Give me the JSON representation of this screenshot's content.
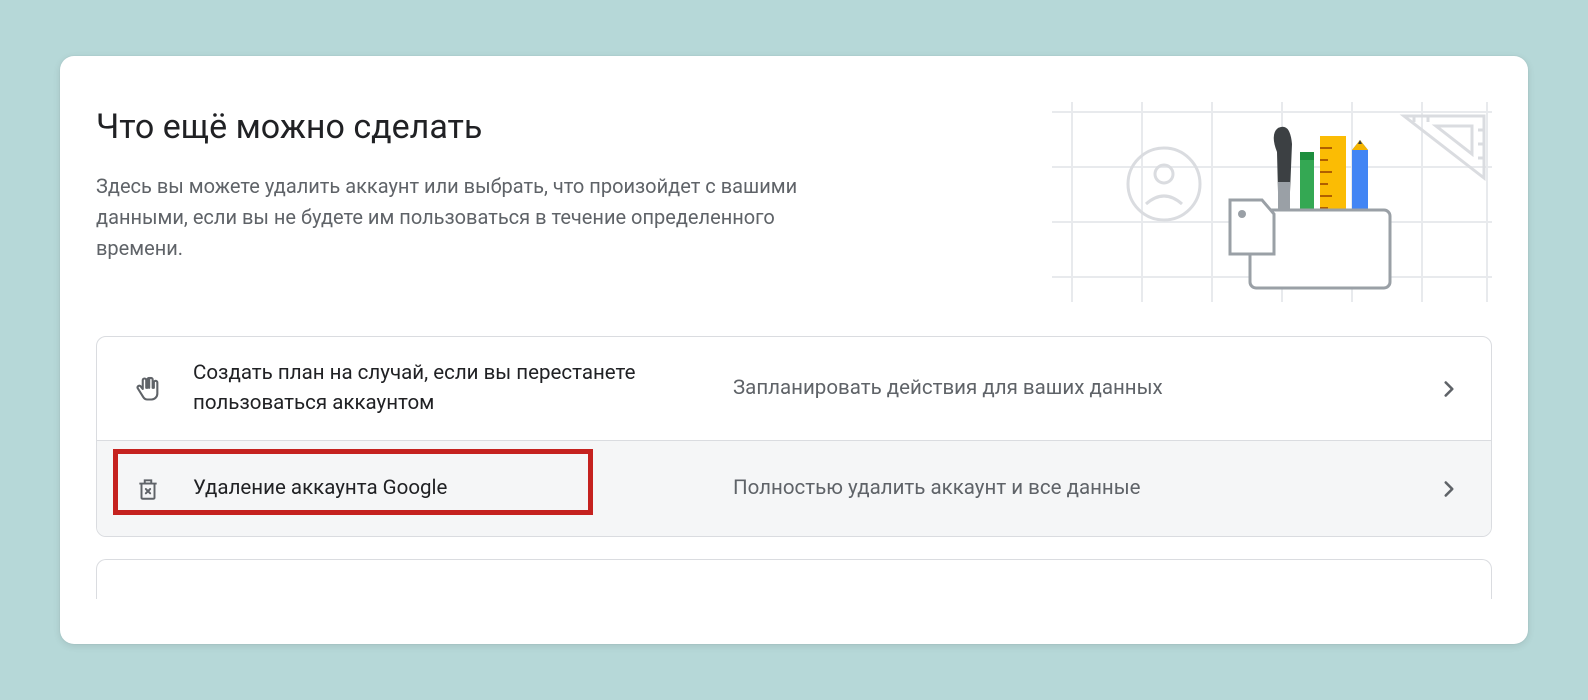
{
  "card": {
    "title": "Что ещё можно сделать",
    "description": "Здесь вы можете удалить аккаунт или выбрать, что произойдет с вашими данными, если вы не будете им пользоваться в течение определенного времени."
  },
  "rows": [
    {
      "icon": "hand-stop-icon",
      "left": "Создать план на случай, если вы перестанете пользоваться аккаунтом",
      "right": "Запланировать действия для ваших данных"
    },
    {
      "icon": "trash-icon",
      "left": "Удаление аккаунта Google",
      "right": "Полностью удалить аккаунт и все данные"
    }
  ]
}
